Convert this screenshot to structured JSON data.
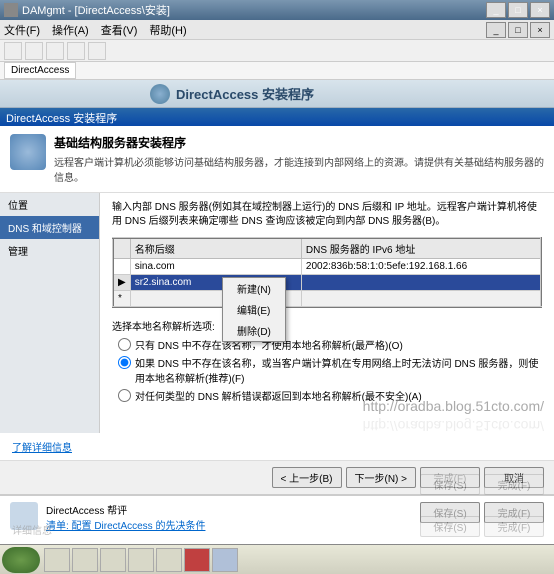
{
  "window": {
    "title": "DAMgmt - [DirectAccess\\安装]",
    "btn_min": "_",
    "btn_max": "□",
    "btn_close": "×"
  },
  "menubar": {
    "file": "文件(F)",
    "action": "操作(A)",
    "view": "查看(V)",
    "help": "帮助(H)"
  },
  "tabs": {
    "tab1": "DirectAccess"
  },
  "header": {
    "title": "DirectAccess 安装程序"
  },
  "wizard": {
    "titlebar": "DirectAccess 安装程序",
    "header_title": "基础结构服务器安装程序",
    "header_desc": "远程客户端计算机必须能够访问基础结构服务器，才能连接到内部网络上的资源。请提供有关基础结构服务器的信息。"
  },
  "sidebar": {
    "items": [
      {
        "label": "位置"
      },
      {
        "label": "DNS 和域控制器"
      },
      {
        "label": "管理"
      }
    ]
  },
  "main": {
    "desc": "输入内部 DNS 服务器(例如其在域控制器上运行)的 DNS 后缀和 IP 地址。远程客户端计算机将使用 DNS 后缀列表来确定哪些 DNS 查询应该被定向到内部 DNS 服务器(B)。",
    "col1": "名称后缀",
    "col2": "DNS 服务器的 IPv6 地址",
    "rows": [
      {
        "suffix": "sina.com",
        "addr": "2002:836b:58:1:0:5efe:192.168.1.66"
      },
      {
        "suffix": "sr2.sina.com",
        "addr": ""
      },
      {
        "suffix": "*",
        "addr": ""
      }
    ],
    "ctx_new": "新建(N)",
    "ctx_edit": "编辑(E)",
    "ctx_delete": "删除(D)",
    "opt_label": "选择本地名称解析选项:",
    "opt1": "只有 DNS 中不存在该名称，才使用本地名称解析(最严格)(O)",
    "opt2": "如果 DNS 中不存在该名称，或当客户端计算机在专用网络上时无法访问 DNS 服务器，则使用本地名称解析(推荐)(F)",
    "opt3": "对任何类型的 DNS 解析错误都返回到本地名称解析(最不安全)(A)"
  },
  "link": {
    "more": "了解详细信息"
  },
  "buttons": {
    "prev": "< 上一步(B)",
    "next": "下一步(N) >",
    "finish": "完成(F)",
    "cancel": "取消",
    "save": "保存(S)",
    "finish2": "完成(F)"
  },
  "lower": {
    "title": "DirectAccess 帮评",
    "link": "清单: 配置 DirectAccess 的先决条件"
  },
  "taskbar": {
    "start": "开始"
  },
  "watermark": "http://oradba.blog.51cto.com/",
  "ghost": {
    "label": "详细信息"
  }
}
